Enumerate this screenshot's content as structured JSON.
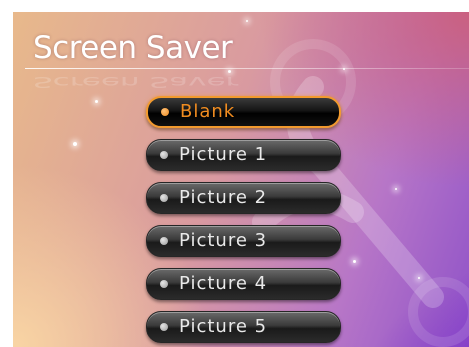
{
  "header": {
    "title": "Screen Saver"
  },
  "menu": {
    "items": [
      {
        "label": "Blank",
        "selected": true
      },
      {
        "label": "Picture 1",
        "selected": false
      },
      {
        "label": "Picture 2",
        "selected": false
      },
      {
        "label": "Picture 3",
        "selected": false
      },
      {
        "label": "Picture 4",
        "selected": false
      },
      {
        "label": "Picture 5",
        "selected": false
      }
    ]
  },
  "colors": {
    "accent": "#f08c20",
    "item_text": "#e9e9e9",
    "background_start": "#e8b98b",
    "background_end": "#8f52c9"
  },
  "icons": {
    "background_watermark": "wrench-icon",
    "menu_bullet": "bullet-dot-icon"
  }
}
